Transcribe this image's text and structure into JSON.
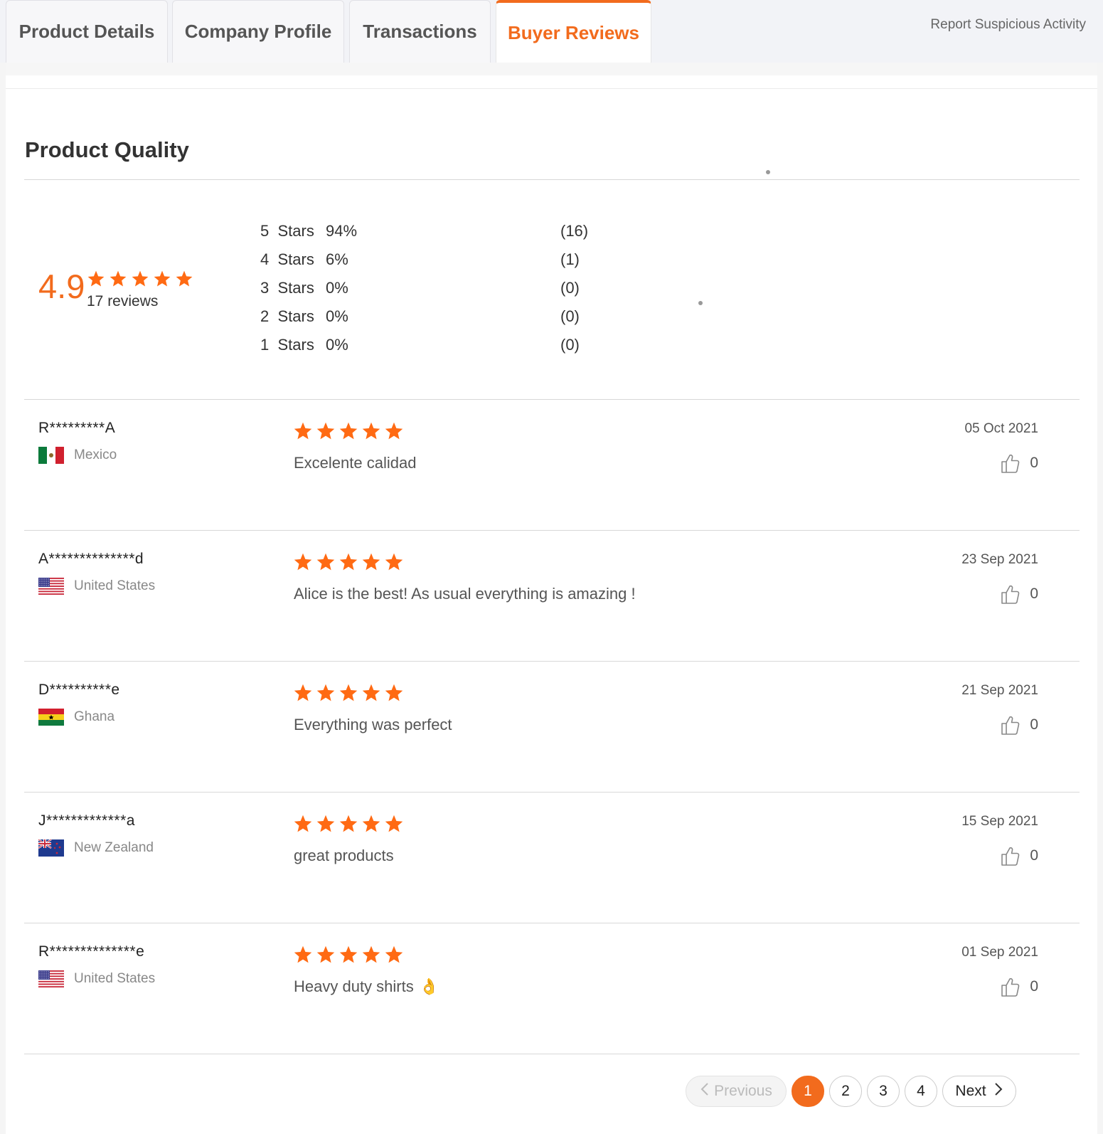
{
  "tabs": [
    {
      "label": "Product Details",
      "active": false
    },
    {
      "label": "Company Profile",
      "active": false
    },
    {
      "label": "Transactions",
      "active": false
    },
    {
      "label": "Buyer Reviews",
      "active": true
    }
  ],
  "report_link": "Report Suspicious Activity",
  "section_title": "Product Quality",
  "summary": {
    "average": "4.9",
    "stars_filled": 5,
    "reviews_label": "17 reviews",
    "distribution": [
      {
        "stars": "5",
        "unit": "Stars",
        "percent": "94%",
        "count": "(16)"
      },
      {
        "stars": "4",
        "unit": "Stars",
        "percent": "6%",
        "count": "(1)"
      },
      {
        "stars": "3",
        "unit": "Stars",
        "percent": "0%",
        "count": "(0)"
      },
      {
        "stars": "2",
        "unit": "Stars",
        "percent": "0%",
        "count": "(0)"
      },
      {
        "stars": "1",
        "unit": "Stars",
        "percent": "0%",
        "count": "(0)"
      }
    ]
  },
  "reviews": [
    {
      "reviewer": "R*********A",
      "country": "Mexico",
      "flag": "mexico-flag",
      "rating": 5,
      "comment": "Excelente calidad",
      "emoji": "",
      "date": "05 Oct 2021",
      "likes": "0"
    },
    {
      "reviewer": "A**************d",
      "country": "United States",
      "flag": "us-flag",
      "rating": 5,
      "comment": "Alice is the best! As usual everything is amazing !",
      "emoji": "",
      "date": "23 Sep 2021",
      "likes": "0"
    },
    {
      "reviewer": "D**********e",
      "country": "Ghana",
      "flag": "ghana-flag",
      "rating": 5,
      "comment": "Everything was perfect",
      "emoji": "",
      "date": "21 Sep 2021",
      "likes": "0"
    },
    {
      "reviewer": "J*************a",
      "country": "New Zealand",
      "flag": "new-zealand-flag",
      "rating": 5,
      "comment": "great products",
      "emoji": "",
      "date": "15 Sep 2021",
      "likes": "0"
    },
    {
      "reviewer": "R**************e",
      "country": "United States",
      "flag": "us-flag",
      "rating": 5,
      "comment": "Heavy duty shirts",
      "emoji": "👌",
      "date": "01 Sep 2021",
      "likes": "0"
    }
  ],
  "pagination": {
    "previous_label": "Previous",
    "next_label": "Next",
    "pages": [
      "1",
      "2",
      "3",
      "4"
    ],
    "current": "1"
  },
  "colors": {
    "accent": "#f26b1d",
    "star": "#ff6a13"
  }
}
